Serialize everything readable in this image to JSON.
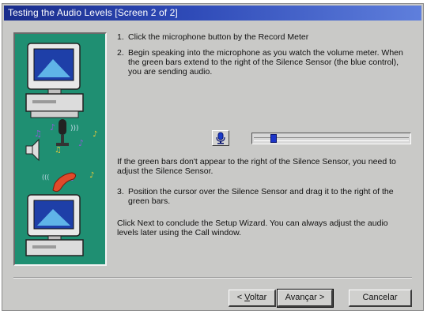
{
  "window": {
    "title": "Testing the Audio Levels [Screen 2 of 2]"
  },
  "steps": [
    {
      "num": "1.",
      "text": "Click the microphone button by the Record Meter"
    },
    {
      "num": "2.",
      "text": "Begin speaking into the microphone as you watch the volume meter. When the green bars extend to the right of the Silence Sensor (the blue control), you are sending audio."
    },
    {
      "num": "3.",
      "text": "Position the cursor over the Silence Sensor and drag it to the right of the green bars."
    }
  ],
  "note_text": "If the green bars don't appear to the right of the Silence Sensor, you need to adjust the Silence Sensor.",
  "conclusion_text": "Click Next to conclude the Setup Wizard. You can always adjust the audio levels later using the Call window.",
  "record_meter": {
    "mic_icon": "microphone-icon",
    "silence_sensor_level": 0.11
  },
  "buttons": {
    "back_prefix": "< ",
    "back_key": "V",
    "back_rest": "oltar",
    "next_label": "Avançar >",
    "cancel_label": "Cancelar"
  },
  "colors": {
    "titlebar": "#1a2d8c",
    "art_bg": "#1f8f72",
    "sensor": "#1d35c9"
  }
}
